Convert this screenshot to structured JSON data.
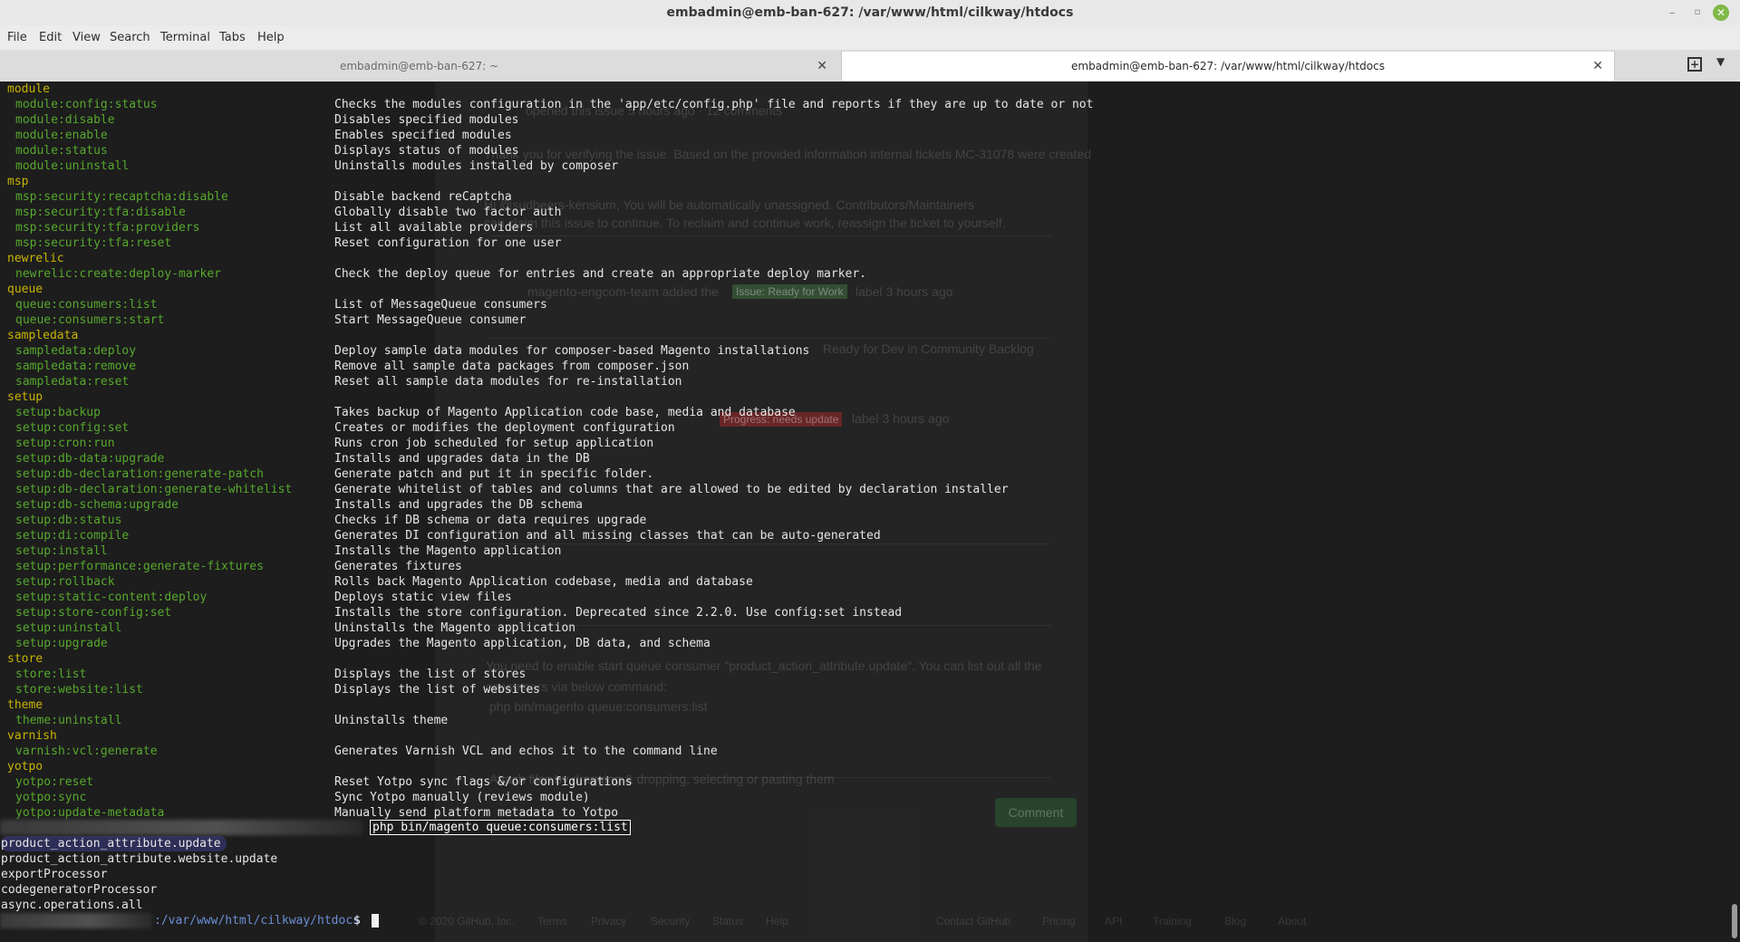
{
  "window": {
    "title": "embadmin@emb-ban-627: /var/www/html/cilkway/htdocs",
    "controls": {
      "minimize": "–",
      "maximize": "▫",
      "close": "✕"
    }
  },
  "menu": [
    "File",
    "Edit",
    "View",
    "Search",
    "Terminal",
    "Tabs",
    "Help"
  ],
  "tabs": [
    {
      "label": "embadmin@emb-ban-627: ~",
      "active": false,
      "close": "✕"
    },
    {
      "label": "embadmin@emb-ban-627: /var/www/html/cilkway/htdocs",
      "active": true,
      "close": "✕"
    }
  ],
  "tab_actions": {
    "new_tab": "+",
    "menu": "▼"
  },
  "terminal": {
    "commands": [
      {
        "kind": "group",
        "name": "module",
        "desc": ""
      },
      {
        "kind": "sub",
        "name": "module:config:status",
        "desc": "Checks the modules configuration in the 'app/etc/config.php' file and reports if they are up to date or not"
      },
      {
        "kind": "sub",
        "name": "module:disable",
        "desc": "Disables specified modules"
      },
      {
        "kind": "sub",
        "name": "module:enable",
        "desc": "Enables specified modules"
      },
      {
        "kind": "sub",
        "name": "module:status",
        "desc": "Displays status of modules"
      },
      {
        "kind": "sub",
        "name": "module:uninstall",
        "desc": "Uninstalls modules installed by composer"
      },
      {
        "kind": "group",
        "name": "msp",
        "desc": ""
      },
      {
        "kind": "sub",
        "name": "msp:security:recaptcha:disable",
        "desc": "Disable backend reCaptcha"
      },
      {
        "kind": "sub",
        "name": "msp:security:tfa:disable",
        "desc": "Globally disable two factor auth"
      },
      {
        "kind": "sub",
        "name": "msp:security:tfa:providers",
        "desc": "List all available providers"
      },
      {
        "kind": "sub",
        "name": "msp:security:tfa:reset",
        "desc": "Reset configuration for one user"
      },
      {
        "kind": "group",
        "name": "newrelic",
        "desc": ""
      },
      {
        "kind": "sub",
        "name": "newrelic:create:deploy-marker",
        "desc": "Check the deploy queue for entries and create an appropriate deploy marker."
      },
      {
        "kind": "group",
        "name": "queue",
        "desc": ""
      },
      {
        "kind": "sub",
        "name": "queue:consumers:list",
        "desc": "List of MessageQueue consumers"
      },
      {
        "kind": "sub",
        "name": "queue:consumers:start",
        "desc": "Start MessageQueue consumer"
      },
      {
        "kind": "group",
        "name": "sampledata",
        "desc": ""
      },
      {
        "kind": "sub",
        "name": "sampledata:deploy",
        "desc": "Deploy sample data modules for composer-based Magento installations"
      },
      {
        "kind": "sub",
        "name": "sampledata:remove",
        "desc": "Remove all sample data packages from composer.json"
      },
      {
        "kind": "sub",
        "name": "sampledata:reset",
        "desc": "Reset all sample data modules for re-installation"
      },
      {
        "kind": "group",
        "name": "setup",
        "desc": ""
      },
      {
        "kind": "sub",
        "name": "setup:backup",
        "desc": "Takes backup of Magento Application code base, media and database"
      },
      {
        "kind": "sub",
        "name": "setup:config:set",
        "desc": "Creates or modifies the deployment configuration"
      },
      {
        "kind": "sub",
        "name": "setup:cron:run",
        "desc": "Runs cron job scheduled for setup application"
      },
      {
        "kind": "sub",
        "name": "setup:db-data:upgrade",
        "desc": "Installs and upgrades data in the DB"
      },
      {
        "kind": "sub",
        "name": "setup:db-declaration:generate-patch",
        "desc": "Generate patch and put it in specific folder."
      },
      {
        "kind": "sub",
        "name": "setup:db-declaration:generate-whitelist",
        "desc": "Generate whitelist of tables and columns that are allowed to be edited by declaration installer"
      },
      {
        "kind": "sub",
        "name": "setup:db-schema:upgrade",
        "desc": "Installs and upgrades the DB schema"
      },
      {
        "kind": "sub",
        "name": "setup:db:status",
        "desc": "Checks if DB schema or data requires upgrade"
      },
      {
        "kind": "sub",
        "name": "setup:di:compile",
        "desc": "Generates DI configuration and all missing classes that can be auto-generated"
      },
      {
        "kind": "sub",
        "name": "setup:install",
        "desc": "Installs the Magento application"
      },
      {
        "kind": "sub",
        "name": "setup:performance:generate-fixtures",
        "desc": "Generates fixtures"
      },
      {
        "kind": "sub",
        "name": "setup:rollback",
        "desc": "Rolls back Magento Application codebase, media and database"
      },
      {
        "kind": "sub",
        "name": "setup:static-content:deploy",
        "desc": "Deploys static view files"
      },
      {
        "kind": "sub",
        "name": "setup:store-config:set",
        "desc": "Installs the store configuration. Deprecated since 2.2.0. Use config:set instead"
      },
      {
        "kind": "sub",
        "name": "setup:uninstall",
        "desc": "Uninstalls the Magento application"
      },
      {
        "kind": "sub",
        "name": "setup:upgrade",
        "desc": "Upgrades the Magento application, DB data, and schema"
      },
      {
        "kind": "group",
        "name": "store",
        "desc": ""
      },
      {
        "kind": "sub",
        "name": "store:list",
        "desc": "Displays the list of stores"
      },
      {
        "kind": "sub",
        "name": "store:website:list",
        "desc": "Displays the list of websites"
      },
      {
        "kind": "group",
        "name": "theme",
        "desc": ""
      },
      {
        "kind": "sub",
        "name": "theme:uninstall",
        "desc": "Uninstalls theme"
      },
      {
        "kind": "group",
        "name": "varnish",
        "desc": ""
      },
      {
        "kind": "sub",
        "name": "varnish:vcl:generate",
        "desc": "Generates Varnish VCL and echos it to the command line"
      },
      {
        "kind": "group",
        "name": "yotpo",
        "desc": ""
      },
      {
        "kind": "sub",
        "name": "yotpo:reset",
        "desc": "Reset Yotpo sync flags &/or configurations"
      },
      {
        "kind": "sub",
        "name": "yotpo:sync",
        "desc": "Sync Yotpo manually (reviews module)"
      },
      {
        "kind": "sub",
        "name": "yotpo:update-metadata",
        "desc": "Manually send platform metadata to Yotpo"
      }
    ],
    "typed_command": "php bin/magento queue:consumers:list",
    "output": [
      {
        "text": "product_action_attribute.update",
        "highlight": true
      },
      {
        "text": "product_action_attribute.website.update",
        "highlight": false
      },
      {
        "text": "exportProcessor",
        "highlight": false
      },
      {
        "text": "codegeneratorProcessor",
        "highlight": false
      },
      {
        "text": "async.operations.all",
        "highlight": false
      }
    ],
    "prompt": {
      "path": ":/var/www/html/cilkway/htdocs",
      "sign": "$"
    }
  },
  "background_page": {
    "lines": [
      "Thank you for verifying the issue. Based on the provided information internal tickets MC-31078 were created",
      "Hi @sudheers-kensium, You will be automatically unassigned. Contributors/Maintainers",
      "can claim this issue to continue. To reclaim and continue work, reassign the ticket to yourself.",
      "magento-engcom-team added the",
      "label 3 hours ago",
      "Ready for Dev in Community Backlog",
      "label 3 hours ago",
      "You need to enable start queue consumer \"product_action_attribute.update\". You can list out all the",
      "consumers via below command:",
      "php bin/magento queue:consumers:list",
      "Attach files by dragging & dropping, selecting or pasting them",
      "opened this issue 5 hours ago · 12 comments"
    ],
    "label_ready": "Issue: Ready for Work",
    "label_progress": "Progress: needs update",
    "comment_button": "Comment",
    "footer": [
      "© 2020 GitHub, Inc.",
      "Terms",
      "Privacy",
      "Security",
      "Status",
      "Help",
      "Contact GitHub",
      "Pricing",
      "API",
      "Training",
      "Blog",
      "About"
    ]
  },
  "colors": {
    "group": "#c8b400",
    "command": "#56a82c",
    "text": "#e6e6e6",
    "path": "#6c8fd6",
    "background": "#1d1d1d"
  }
}
